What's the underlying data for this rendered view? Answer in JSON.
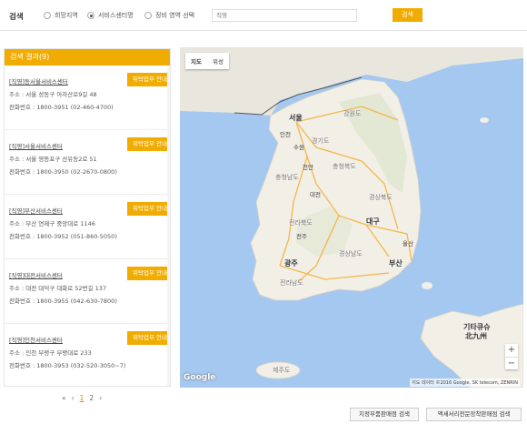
{
  "search": {
    "label": "검색",
    "radios": [
      {
        "label": "희망지역",
        "selected": false
      },
      {
        "label": "서비스센터명",
        "selected": true
      },
      {
        "label": "정비 영역 선택",
        "selected": false
      }
    ],
    "placeholder": "직영",
    "button": "검색"
  },
  "results": {
    "header": "검색 결과(9)",
    "contact_label": "위탁업무 안내",
    "items": [
      {
        "name": "[직영]동서울서비스센터",
        "addr": "주소 : 서울 성동구 아차산로9길 48",
        "phone": "전화번호 : 1800-3951 (02-460-4700)"
      },
      {
        "name": "[직영]서울서비스센터",
        "addr": "주소 : 서울 영등포구 선유동2로 51",
        "phone": "전화번호 : 1800-3950 (02-2670-0800)"
      },
      {
        "name": "[직영]부산서비스센터",
        "addr": "주소 : 부산 연제구 중앙대로 1146",
        "phone": "전화번호 : 1800-3952 (051-860-5050)"
      },
      {
        "name": "[직영]대전서비스센터",
        "addr": "주소 : 대전 대덕구 대화로 52번길 137",
        "phone": "전화번호 : 1800-3955 (042-630-7800)"
      },
      {
        "name": "[직영]인천서비스센터",
        "addr": "주소 : 인천 부평구 부평대로 233",
        "phone": "전화번호 : 1800-3953 (032-520-3050~7)"
      }
    ]
  },
  "pagination": {
    "prev": "‹",
    "first": "«",
    "pages": [
      "1",
      "2"
    ],
    "current": "1",
    "next": "›",
    "last": "»"
  },
  "map": {
    "type_buttons": [
      "지도",
      "위성"
    ],
    "zoom_in": "+",
    "zoom_out": "−",
    "logo": "Google",
    "attribution": "지도 데이터 ©2016 Google, SK telecom, ZENRIN",
    "labels": {
      "seoul": "서울",
      "incheon": "인천",
      "suwon": "수원",
      "gangwon": "강원도",
      "gyeonggi": "경기도",
      "cheonan": "천안",
      "chungbuk": "충청북도",
      "chungnam": "충청남도",
      "daejeon": "대전",
      "gyeongbuk": "경상북도",
      "daegu": "대구",
      "jeonbuk": "전라북도",
      "jeonju": "전주",
      "gwangju": "광주",
      "jeonnam": "전라남도",
      "gyeongnam": "경상남도",
      "ulsan": "울산",
      "busan": "부산",
      "jeju": "제주도",
      "kitakyushu": "기타큐슈",
      "kitakyushu_kanji": "北九州"
    },
    "colors": {
      "sea": "#a5c8f0",
      "land": "#f2efe7",
      "north": "#e9e6dd",
      "road": "#f5b64a"
    }
  },
  "footer": {
    "button1": "지정부품판매점 검색",
    "button2": "액세서리전문장착판매점 검색"
  }
}
